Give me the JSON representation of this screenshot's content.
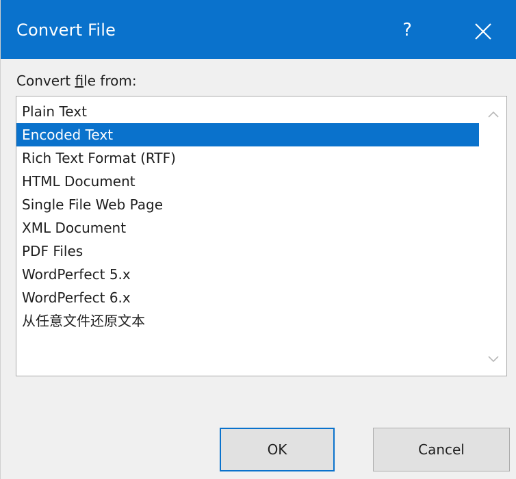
{
  "dialog": {
    "title": "Convert File",
    "help_glyph": "?",
    "close_glyph": "close-icon"
  },
  "list": {
    "label_prefix": "Convert ",
    "label_mnemonic": "f",
    "label_suffix": "ile from:",
    "items": [
      "Plain Text",
      "Encoded Text",
      "Rich Text Format (RTF)",
      "HTML Document",
      "Single File Web Page",
      "XML Document",
      "PDF Files",
      "WordPerfect 5.x",
      "WordPerfect 6.x",
      "从任意文件还原文本"
    ],
    "selected_index": 1
  },
  "buttons": {
    "ok_label": "OK",
    "cancel_label": "Cancel"
  },
  "colors": {
    "accent": "#0a72cc",
    "dialog_bg": "#f0f0f0"
  }
}
